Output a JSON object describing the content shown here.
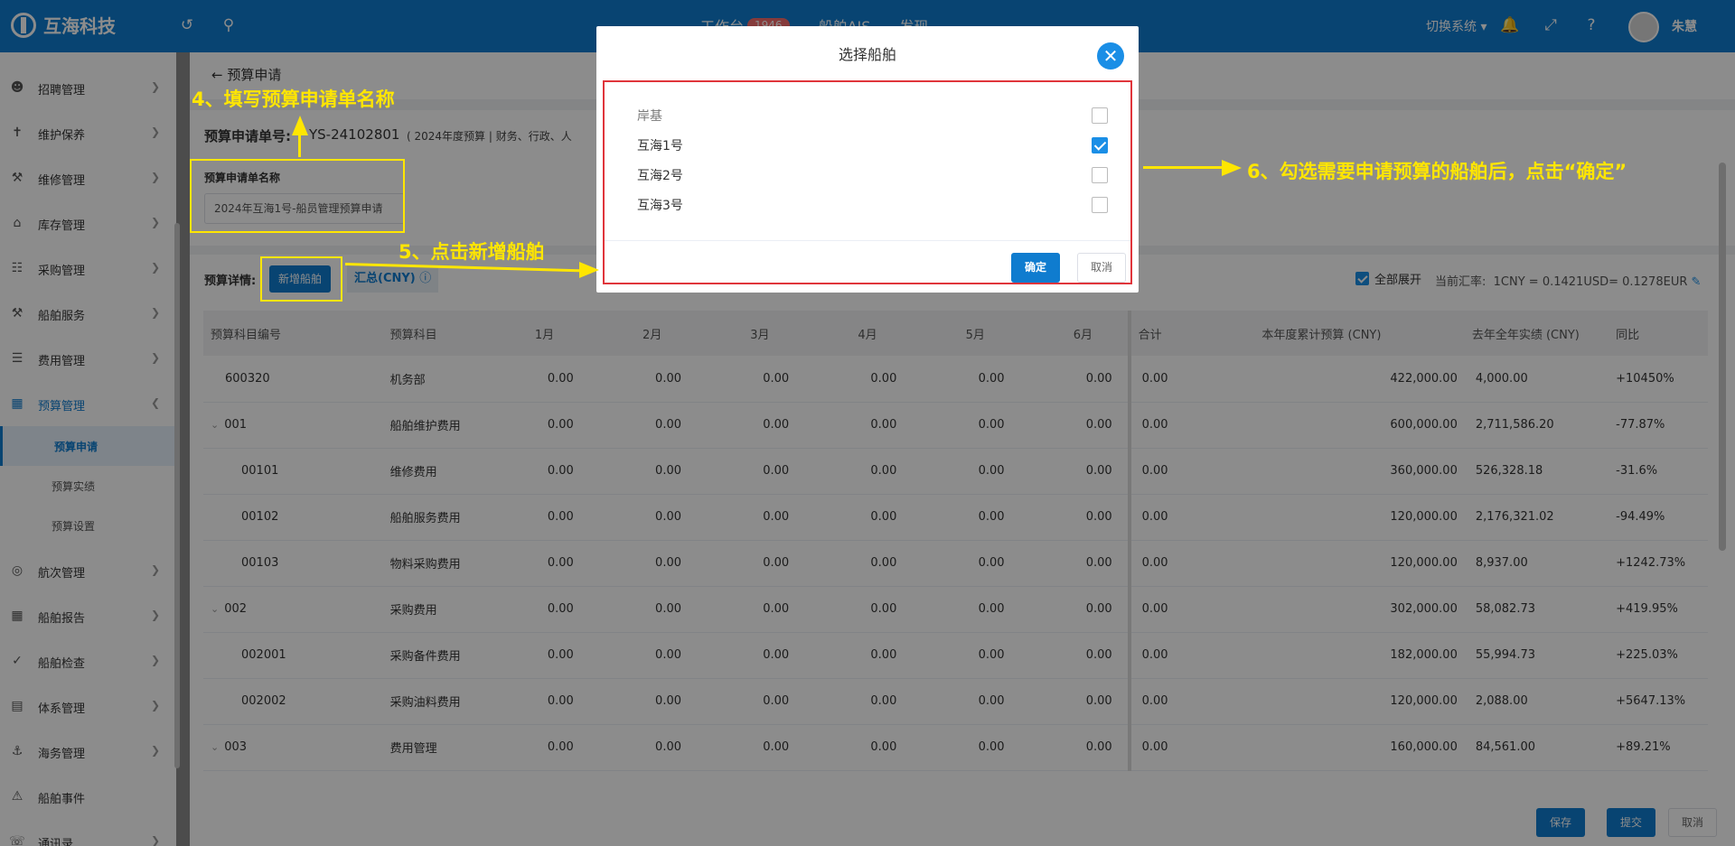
{
  "app": {
    "title": "互海科技",
    "user": "朱慧",
    "switch_system": "切换系统"
  },
  "top_tabs": [
    {
      "label": "工作台",
      "badge": "1946"
    },
    {
      "label": "船舶AIS",
      "badge": ""
    },
    {
      "label": "发现",
      "badge": ""
    }
  ],
  "sidebar": {
    "items": [
      {
        "label": "招聘管理",
        "icon": "person-icon"
      },
      {
        "label": "维护保养",
        "icon": "wrench-icon"
      },
      {
        "label": "维修管理",
        "icon": "tool-icon"
      },
      {
        "label": "库存管理",
        "icon": "home-icon"
      },
      {
        "label": "采购管理",
        "icon": "cart-icon"
      },
      {
        "label": "船舶服务",
        "icon": "hammer-icon"
      },
      {
        "label": "费用管理",
        "icon": "coins-icon"
      },
      {
        "label": "预算管理",
        "icon": "budget-icon"
      },
      {
        "label": "航次管理",
        "icon": "globe-icon"
      },
      {
        "label": "船舶报告",
        "icon": "calendar-icon"
      },
      {
        "label": "船舶检查",
        "icon": "check-circle-icon"
      },
      {
        "label": "体系管理",
        "icon": "doc-icon"
      },
      {
        "label": "海务管理",
        "icon": "anchor-icon"
      },
      {
        "label": "船舶事件",
        "icon": "warning-icon"
      },
      {
        "label": "通讯录",
        "icon": "contacts-icon"
      }
    ],
    "sub_items": [
      "预算申请",
      "预算实绩",
      "预算设置"
    ]
  },
  "page": {
    "back_title": "预算申请",
    "doc_label": "预算申请单号:",
    "doc_no": "YS-24102801",
    "doc_meta": "( 2024年度预算 | 财务、行政、人",
    "name_label": "预算申请单名称",
    "name_value": "2024年互海1号-船员管理预算申请",
    "detail_label": "预算详情:",
    "add_ship_btn": "新增船舶",
    "summary_tab": "汇总(CNY)",
    "expand_all": "全部展开",
    "rate_label": "当前汇率:",
    "rate_value": "1CNY = 0.1421USD= 0.1278EUR",
    "save_btn": "保存",
    "submit_btn": "提交",
    "cancel_btn": "取消"
  },
  "table": {
    "headers": [
      "预算科目编号",
      "预算科目",
      "1月",
      "2月",
      "3月",
      "4月",
      "5月",
      "6月",
      "合计",
      "本年度累计预算 (CNY)",
      "去年全年实绩 (CNY)",
      "同比"
    ],
    "rows": [
      {
        "code": "600320",
        "name": "机务部",
        "months": [
          "0.00",
          "0.00",
          "0.00",
          "0.00",
          "0.00",
          "0.00"
        ],
        "total": "0.00",
        "budget": "422,000.00",
        "last": "4,000.00",
        "yoy": "+10450%",
        "trend": "pos",
        "level": 0,
        "caret": false
      },
      {
        "code": "001",
        "name": "船舶维护费用",
        "months": [
          "0.00",
          "0.00",
          "0.00",
          "0.00",
          "0.00",
          "0.00"
        ],
        "total": "0.00",
        "budget": "600,000.00",
        "last": "2,711,586.20",
        "yoy": "-77.87%",
        "trend": "neg",
        "level": 0,
        "caret": true
      },
      {
        "code": "00101",
        "name": "维修费用",
        "months": [
          "0.00",
          "0.00",
          "0.00",
          "0.00",
          "0.00",
          "0.00"
        ],
        "total": "0.00",
        "budget": "360,000.00",
        "last": "526,328.18",
        "yoy": "-31.6%",
        "trend": "neg",
        "level": 1,
        "caret": false
      },
      {
        "code": "00102",
        "name": "船舶服务费用",
        "months": [
          "0.00",
          "0.00",
          "0.00",
          "0.00",
          "0.00",
          "0.00"
        ],
        "total": "0.00",
        "budget": "120,000.00",
        "last": "2,176,321.02",
        "yoy": "-94.49%",
        "trend": "neg",
        "level": 1,
        "caret": false
      },
      {
        "code": "00103",
        "name": "物料采购费用",
        "months": [
          "0.00",
          "0.00",
          "0.00",
          "0.00",
          "0.00",
          "0.00"
        ],
        "total": "0.00",
        "budget": "120,000.00",
        "last": "8,937.00",
        "yoy": "+1242.73%",
        "trend": "pos",
        "level": 1,
        "caret": false
      },
      {
        "code": "002",
        "name": "采购费用",
        "months": [
          "0.00",
          "0.00",
          "0.00",
          "0.00",
          "0.00",
          "0.00"
        ],
        "total": "0.00",
        "budget": "302,000.00",
        "last": "58,082.73",
        "yoy": "+419.95%",
        "trend": "pos",
        "level": 0,
        "caret": true
      },
      {
        "code": "002001",
        "name": "采购备件费用",
        "months": [
          "0.00",
          "0.00",
          "0.00",
          "0.00",
          "0.00",
          "0.00"
        ],
        "total": "0.00",
        "budget": "182,000.00",
        "last": "55,994.73",
        "yoy": "+225.03%",
        "trend": "pos",
        "level": 1,
        "caret": false
      },
      {
        "code": "002002",
        "name": "采购油料费用",
        "months": [
          "0.00",
          "0.00",
          "0.00",
          "0.00",
          "0.00",
          "0.00"
        ],
        "total": "0.00",
        "budget": "120,000.00",
        "last": "2,088.00",
        "yoy": "+5647.13%",
        "trend": "pos",
        "level": 1,
        "caret": false
      },
      {
        "code": "003",
        "name": "费用管理",
        "months": [
          "0.00",
          "0.00",
          "0.00",
          "0.00",
          "0.00",
          "0.00"
        ],
        "total": "0.00",
        "budget": "160,000.00",
        "last": "84,561.00",
        "yoy": "+89.21%",
        "trend": "pos",
        "level": 0,
        "caret": true
      }
    ]
  },
  "modal": {
    "title": "选择船舶",
    "ships": [
      {
        "label": "岸基",
        "checked": false
      },
      {
        "label": "互海1号",
        "checked": true
      },
      {
        "label": "互海2号",
        "checked": false
      },
      {
        "label": "互海3号",
        "checked": false
      }
    ],
    "confirm": "确定",
    "cancel": "取消"
  },
  "annotations": {
    "step4": "4、填写预算申请单名称",
    "step5": "5、点击新增船舶",
    "step6": "6、勾选需要申请预算的船舶后，点击“确定”"
  },
  "colors": {
    "primary": "#0f7ccf",
    "accent": "#1a8ee6",
    "annotation": "#ffe600",
    "highlight_border": "#e0353b",
    "positive": "#e0353b",
    "negative": "#22a04b"
  }
}
